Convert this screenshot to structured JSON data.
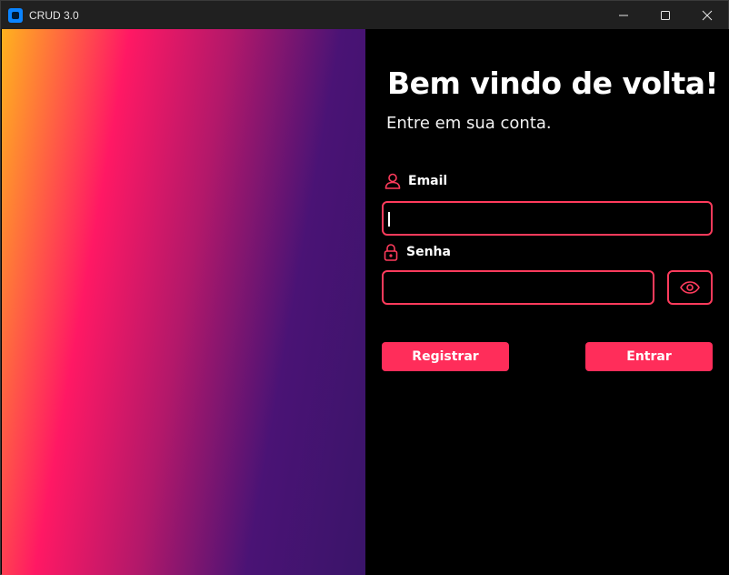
{
  "window": {
    "title": "CRUD 3.0",
    "minimize_icon": "minimize-icon",
    "maximize_icon": "maximize-icon",
    "close_icon": "close-icon"
  },
  "login": {
    "heading": "Bem vindo de volta!",
    "subtitle": "Entre em sua conta.",
    "email_label": "Email",
    "email_value": "",
    "password_label": "Senha",
    "password_value": "",
    "register_label": "Registrar",
    "login_label": "Entrar"
  },
  "colors": {
    "accent": "#ff2d5a",
    "border": "#ff3b5c",
    "background": "#000000",
    "gradient": [
      "#ffb21e",
      "#ff1864",
      "#b3186a",
      "#4a1375",
      "#3a1469"
    ]
  },
  "icons": {
    "email": "user-icon",
    "password": "lock-icon",
    "toggle_password": "eye-icon"
  }
}
